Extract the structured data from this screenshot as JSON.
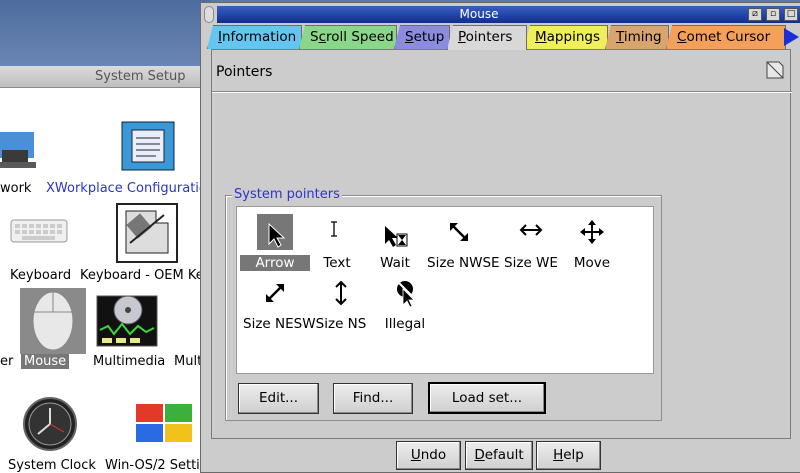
{
  "window": {
    "title": "Mouse",
    "buttons": [
      "restore",
      "minimize",
      "maximize"
    ]
  },
  "tabs": [
    {
      "label": "Information",
      "mnemonic": "I",
      "color": "#63c5f0"
    },
    {
      "label": "Scroll Speed",
      "mnemonic": "c",
      "color": "#8ad78a"
    },
    {
      "label": "Setup",
      "mnemonic": "S",
      "color": "#8b8be0"
    },
    {
      "label": "Pointers",
      "mnemonic": "P",
      "color": "#d8d8d8",
      "active": true
    },
    {
      "label": "Mappings",
      "mnemonic": "M",
      "color": "#efef5a"
    },
    {
      "label": "Timing",
      "mnemonic": "T",
      "color": "#d9a56f"
    },
    {
      "label": "Comet Cursor",
      "mnemonic": "C",
      "color": "#f5a05a"
    }
  ],
  "page": {
    "title": "Pointers",
    "group_label": "System pointers",
    "pointers": [
      {
        "label": "Arrow",
        "icon": "arrow-pointer-icon",
        "selected": true
      },
      {
        "label": "Text",
        "icon": "ibeam-pointer-icon"
      },
      {
        "label": "Wait",
        "icon": "wait-pointer-icon"
      },
      {
        "label": "Size NWSE",
        "icon": "size-nwse-pointer-icon"
      },
      {
        "label": "Size WE",
        "icon": "size-we-pointer-icon"
      },
      {
        "label": "Move",
        "icon": "move-pointer-icon"
      },
      {
        "label": "Size NESW",
        "icon": "size-nesw-pointer-icon"
      },
      {
        "label": "Size NS",
        "icon": "size-ns-pointer-icon"
      },
      {
        "label": "Illegal",
        "icon": "illegal-pointer-icon"
      }
    ],
    "buttons": {
      "edit": "Edit...",
      "find": "Find...",
      "load_set": "Load set..."
    }
  },
  "bottom_buttons": {
    "undo": "Undo",
    "default": "Default",
    "help": "Help"
  },
  "background_window": {
    "title": "System Setup",
    "items": [
      {
        "label": "work",
        "icon": "network-icon"
      },
      {
        "label": "XWorkplace Configuratio",
        "icon": "xworkplace-config-icon",
        "color": "#2a35c8"
      },
      {
        "label": "Keyboard",
        "icon": "keyboard-icon"
      },
      {
        "label": "Keyboard - OEM Ke",
        "icon": "keyboard-oem-icon"
      },
      {
        "label": "er",
        "icon": "printer-icon"
      },
      {
        "label": "Mouse",
        "icon": "mouse-icon",
        "selected": true
      },
      {
        "label": "Multimedia",
        "icon": "multimedia-icon"
      },
      {
        "label": "Mult",
        "icon": "multimedia-2-icon"
      },
      {
        "label": "System Clock",
        "icon": "clock-icon"
      },
      {
        "label": "Win-OS/2 Setti",
        "icon": "win-os2-icon"
      }
    ]
  }
}
